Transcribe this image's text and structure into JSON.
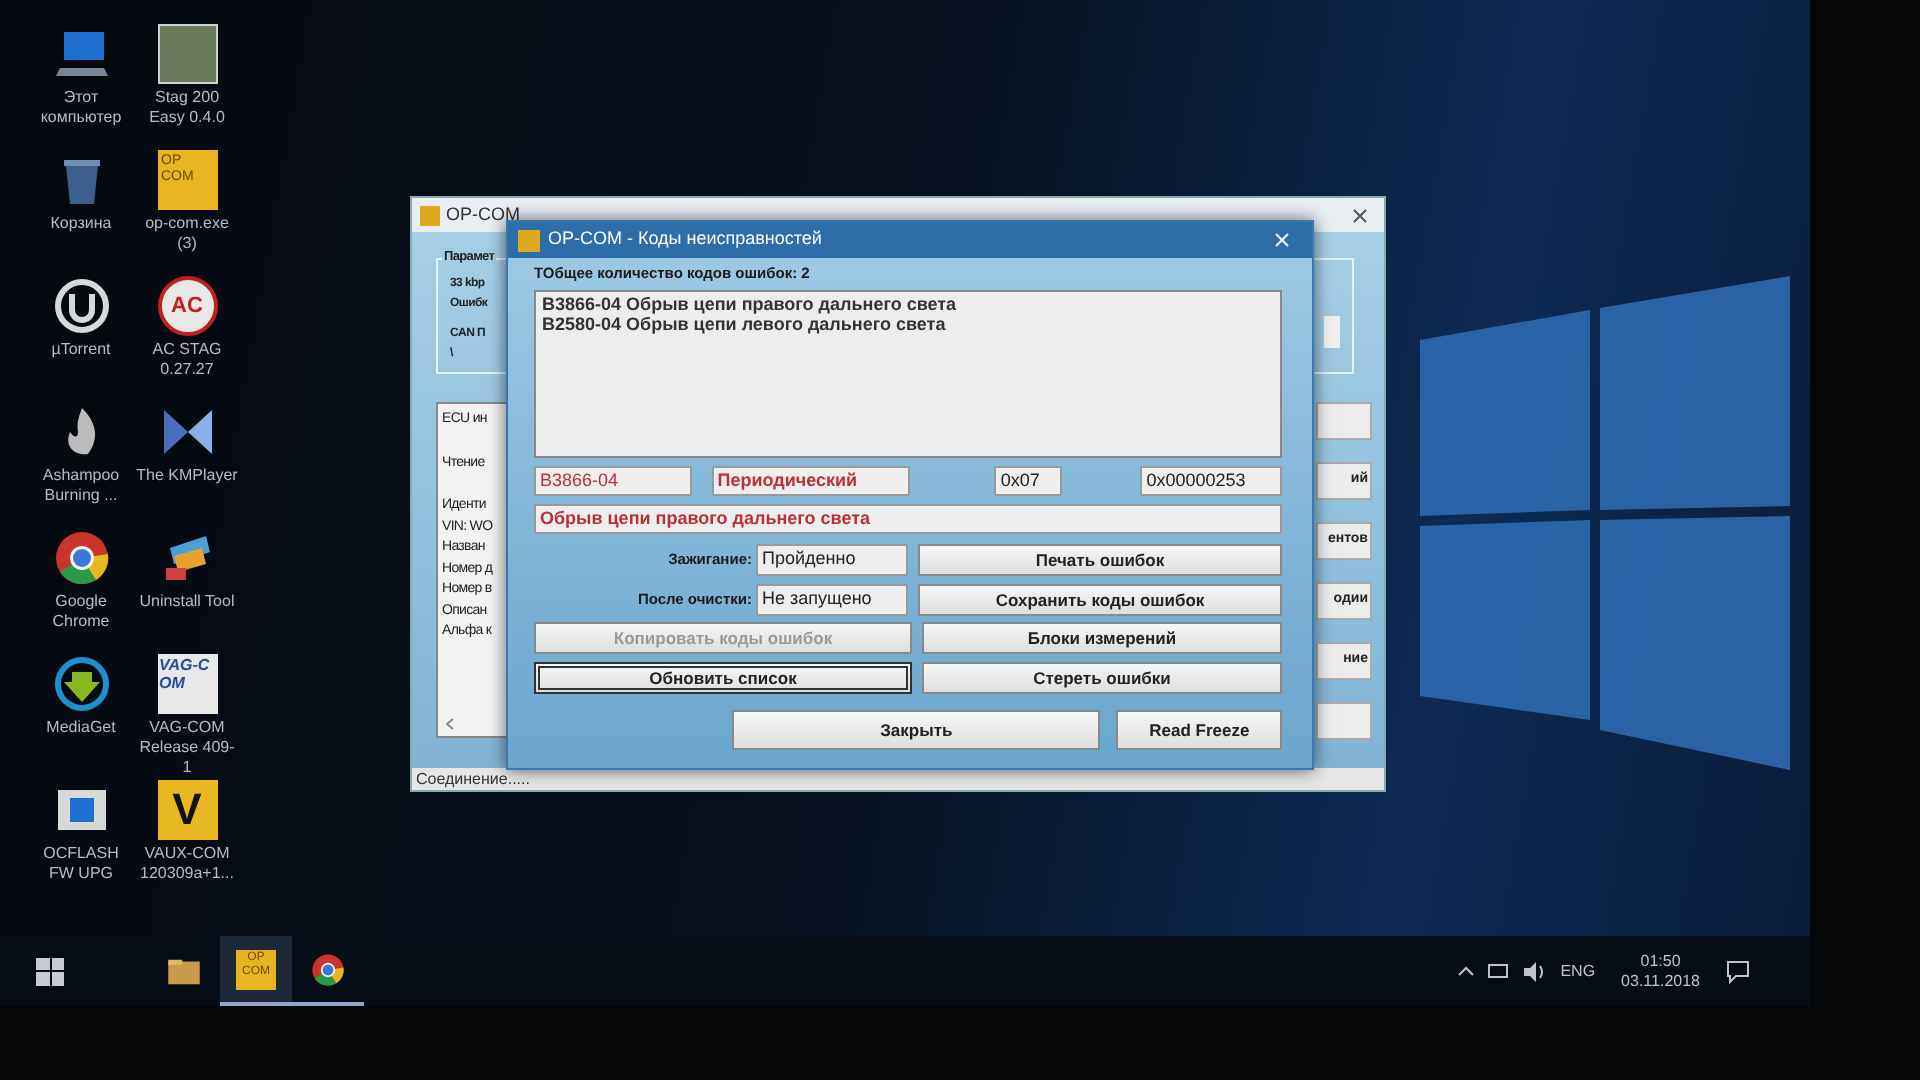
{
  "desktop_icon_rows": [
    {
      "icons": [
        {
          "kind": "computer",
          "label": "Этот компьютер"
        },
        {
          "kind": "stag",
          "label": "Stag 200 Easy 0.4.0"
        }
      ]
    },
    {
      "icons": [
        {
          "kind": "bin",
          "label": "Корзина"
        },
        {
          "kind": "opcom",
          "badge": "OP COM",
          "label": "op-com.exe (3)"
        }
      ]
    },
    {
      "icons": [
        {
          "kind": "utorrent",
          "label": "µTorrent"
        },
        {
          "kind": "acstag",
          "badge": "AC",
          "label": "AC STAG 0.27.27"
        }
      ]
    },
    {
      "icons": [
        {
          "kind": "ashampoo",
          "label": "Ashampoo Burning ..."
        },
        {
          "kind": "kmplayer",
          "label": "The KMPlayer"
        }
      ]
    },
    {
      "icons": [
        {
          "kind": "chrome",
          "label": "Google Chrome"
        },
        {
          "kind": "uninstall",
          "label": "Uninstall Tool"
        }
      ]
    },
    {
      "icons": [
        {
          "kind": "mediaget",
          "label": "MediaGet"
        },
        {
          "kind": "vagcom",
          "badge": "VAG-COM",
          "label": "VAG-COM Release 409-1"
        }
      ]
    },
    {
      "icons": [
        {
          "kind": "ocflash",
          "label": "OCFLASH FW UPG"
        },
        {
          "kind": "vauxcom",
          "badge": "V",
          "label": "VAUX-COM 120309a+1..."
        }
      ]
    }
  ],
  "background_window": {
    "title": "OP-COM",
    "group": {
      "title": "Парамет",
      "lines": [
        "33 kbp",
        "Ошибк",
        "CAN П",
        "\\"
      ]
    },
    "list_groups": [
      [
        "ECU ин"
      ],
      [
        "Чтение"
      ],
      [
        "Иденти",
        "VIN: WO",
        "Назван",
        "Номер д",
        "Номер в",
        "Описан",
        "Альфа к"
      ]
    ],
    "side_buttons": [
      "ий",
      "ентов",
      "одии",
      "ние"
    ],
    "status": "Соединение....."
  },
  "dialog": {
    "title": "OP-COM - Коды неисправностей",
    "count_label": "ТОбщее количество кодов ошибок:  2",
    "faults": [
      "B3866-04 Обрыв цепи правого дальнего света",
      "B2580-04 Обрыв цепи левого дальнего света"
    ],
    "code": "B3866-04",
    "fault_type": "Периодический",
    "status_byte": "0x07",
    "freeze_value": "0x00000253",
    "description": "Обрыв цепи правого дальнего света",
    "ignition": {
      "label": "Зажигание:",
      "value": "Пройденно"
    },
    "after_clear": {
      "label": "После очистки:",
      "value": "Не запущено"
    },
    "right_buttons": [
      "Печать ошибок",
      "Сохранить коды ошибок",
      "Блоки измерений",
      "Стереть ошибки"
    ],
    "left_buttons": [
      {
        "label": "Копировать коды ошибок",
        "disabled": true,
        "focused": false
      },
      {
        "label": "Обновить список",
        "disabled": false,
        "focused": true
      }
    ],
    "bottom_buttons": [
      "Закрыть",
      "Read Freeze"
    ]
  },
  "taskbar": {
    "apps": [
      {
        "kind": "explorer",
        "running": false,
        "active": false
      },
      {
        "kind": "opcom",
        "badge": "OP COM",
        "running": true,
        "active": true
      },
      {
        "kind": "chrome",
        "running": true,
        "active": false
      }
    ],
    "tray": {
      "language": "ENG",
      "time": "01:50",
      "date": "03.11.2018"
    }
  }
}
